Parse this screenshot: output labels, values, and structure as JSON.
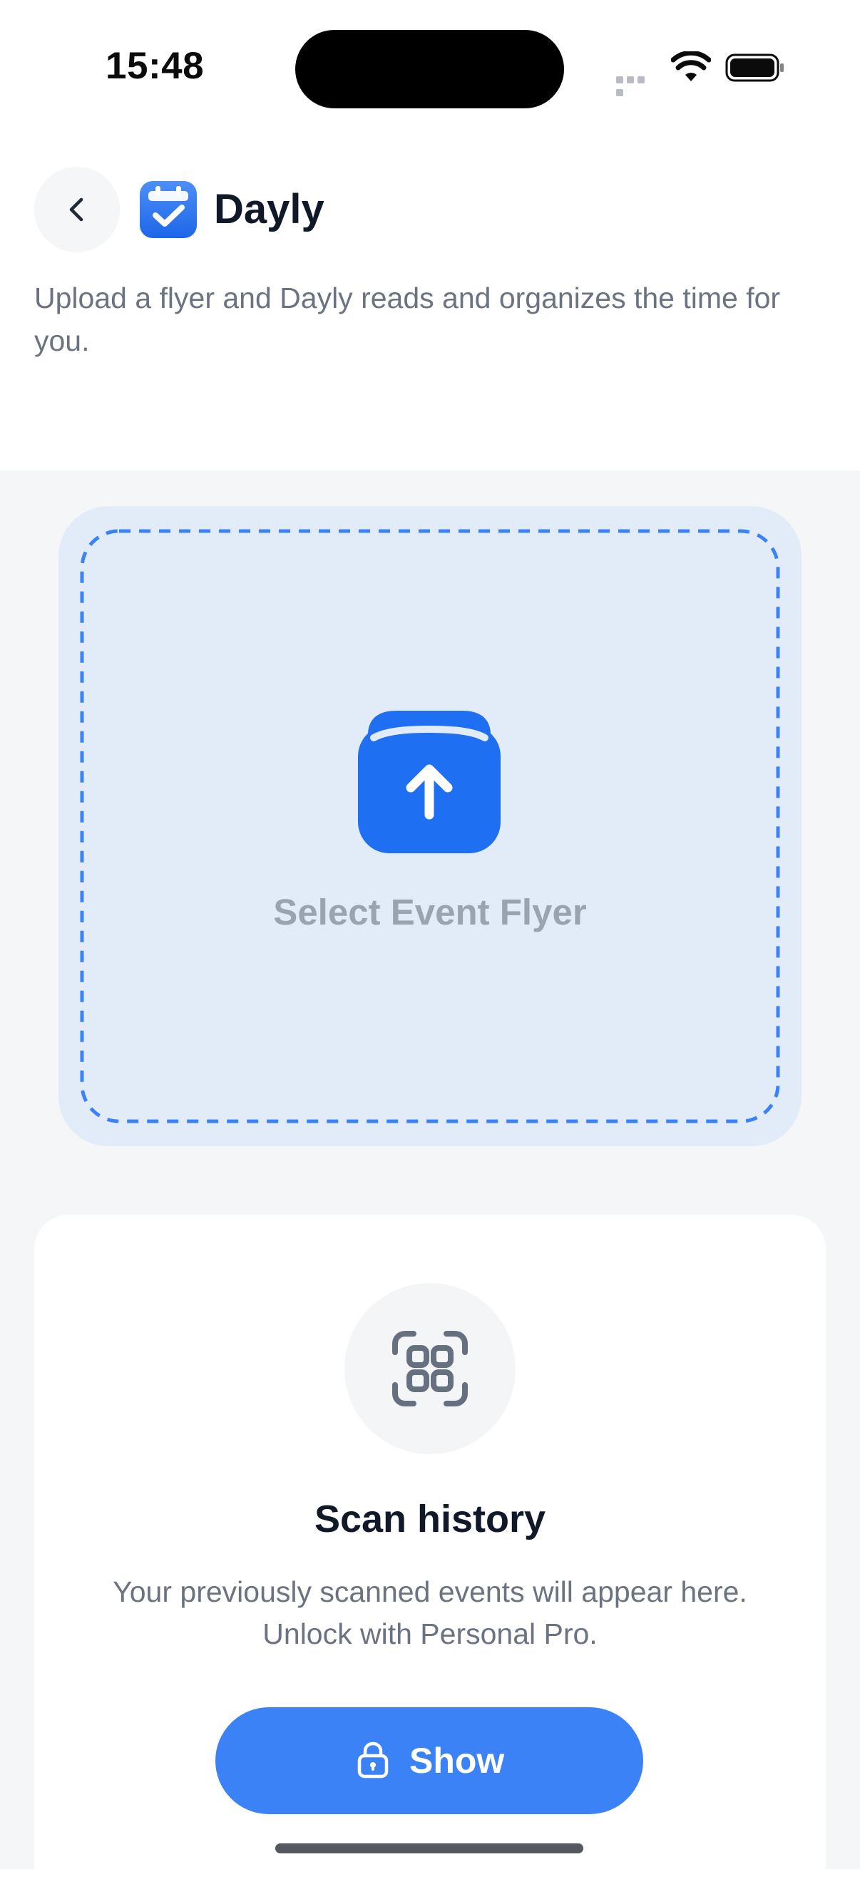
{
  "status_bar": {
    "time": "15:48"
  },
  "header": {
    "app_name": "Dayly",
    "subtitle": "Upload a flyer and Dayly reads and organizes the time for you."
  },
  "upload": {
    "label": "Select Event Flyer"
  },
  "history": {
    "title": "Scan history",
    "description": "Your previously scanned events will appear here. Unlock with Personal Pro.",
    "button_label": "Show"
  },
  "colors": {
    "accent": "#3b82f6",
    "upload_icon": "#1f6ff2",
    "dropzone_bg": "#e1ecf8",
    "page_bg": "#f5f6f7"
  },
  "icons": {
    "back": "chevron-left-icon",
    "logo": "calendar-check-icon",
    "upload": "upload-tray-icon",
    "scan": "qr-scan-icon",
    "lock": "lock-icon"
  }
}
